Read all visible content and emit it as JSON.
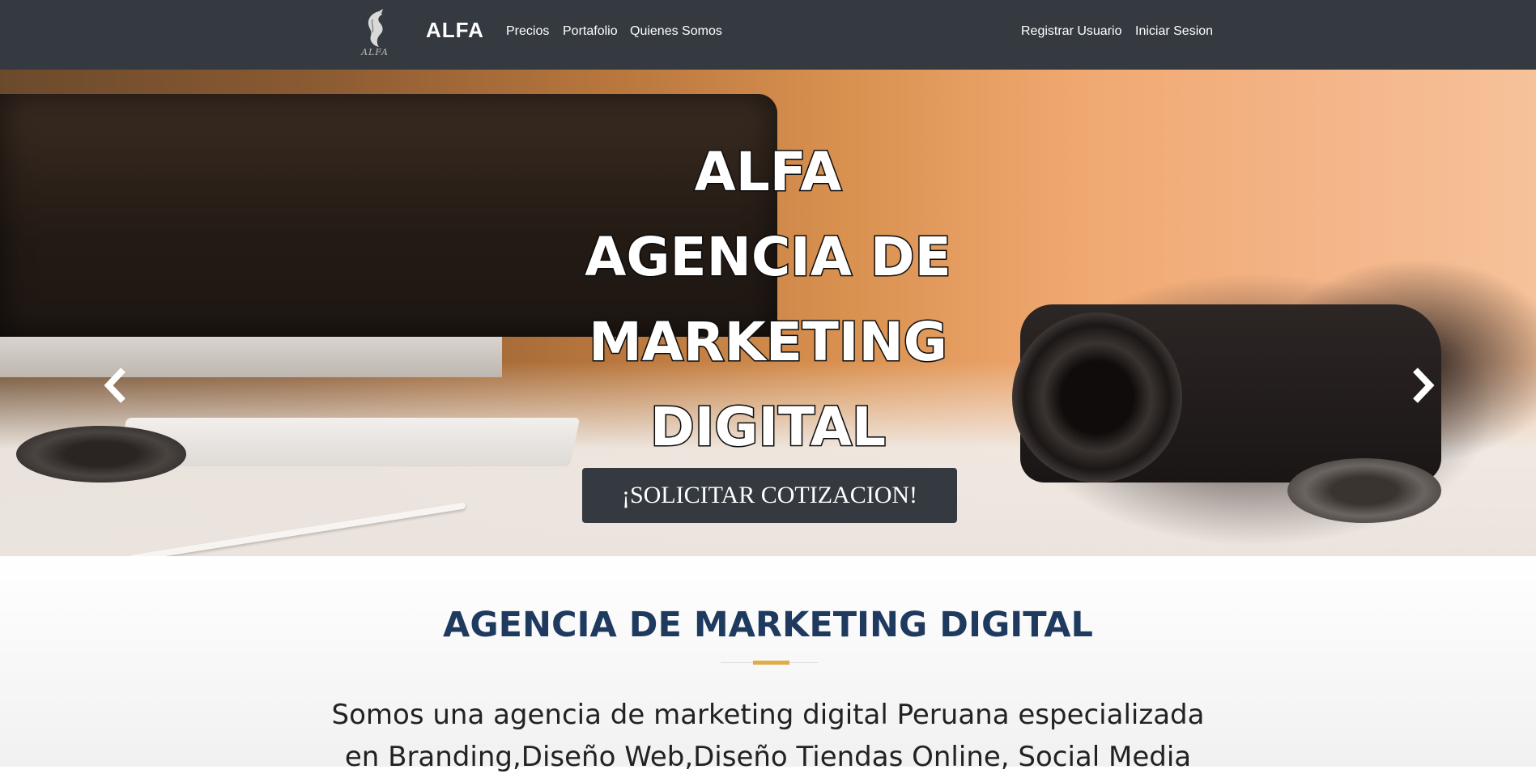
{
  "navbar": {
    "logo_text": "ALFA",
    "brand": "ALFA",
    "links": [
      "Precios",
      "Portafolio",
      "Quienes Somos"
    ],
    "auth_links": [
      "Registrar Usuario",
      "Iniciar Sesion"
    ]
  },
  "hero": {
    "title_lines": [
      "ALFA",
      "AGENCIA DE",
      "MARKETING",
      "DIGITAL"
    ],
    "cta_label": "¡SOLICITAR COTIZACION!",
    "prev_icon": "chevron-left-icon",
    "next_icon": "chevron-right-icon"
  },
  "about": {
    "title": "AGENCIA DE MARKETING DIGITAL",
    "accent_color": "#e0ac4a",
    "text": "Somos una agencia de marketing digital Peruana especializada en Branding,Diseño Web,Diseño Tiendas Online, Social Media"
  },
  "colors": {
    "navbar_bg": "#343a40",
    "title_color": "#1f3a5f"
  }
}
